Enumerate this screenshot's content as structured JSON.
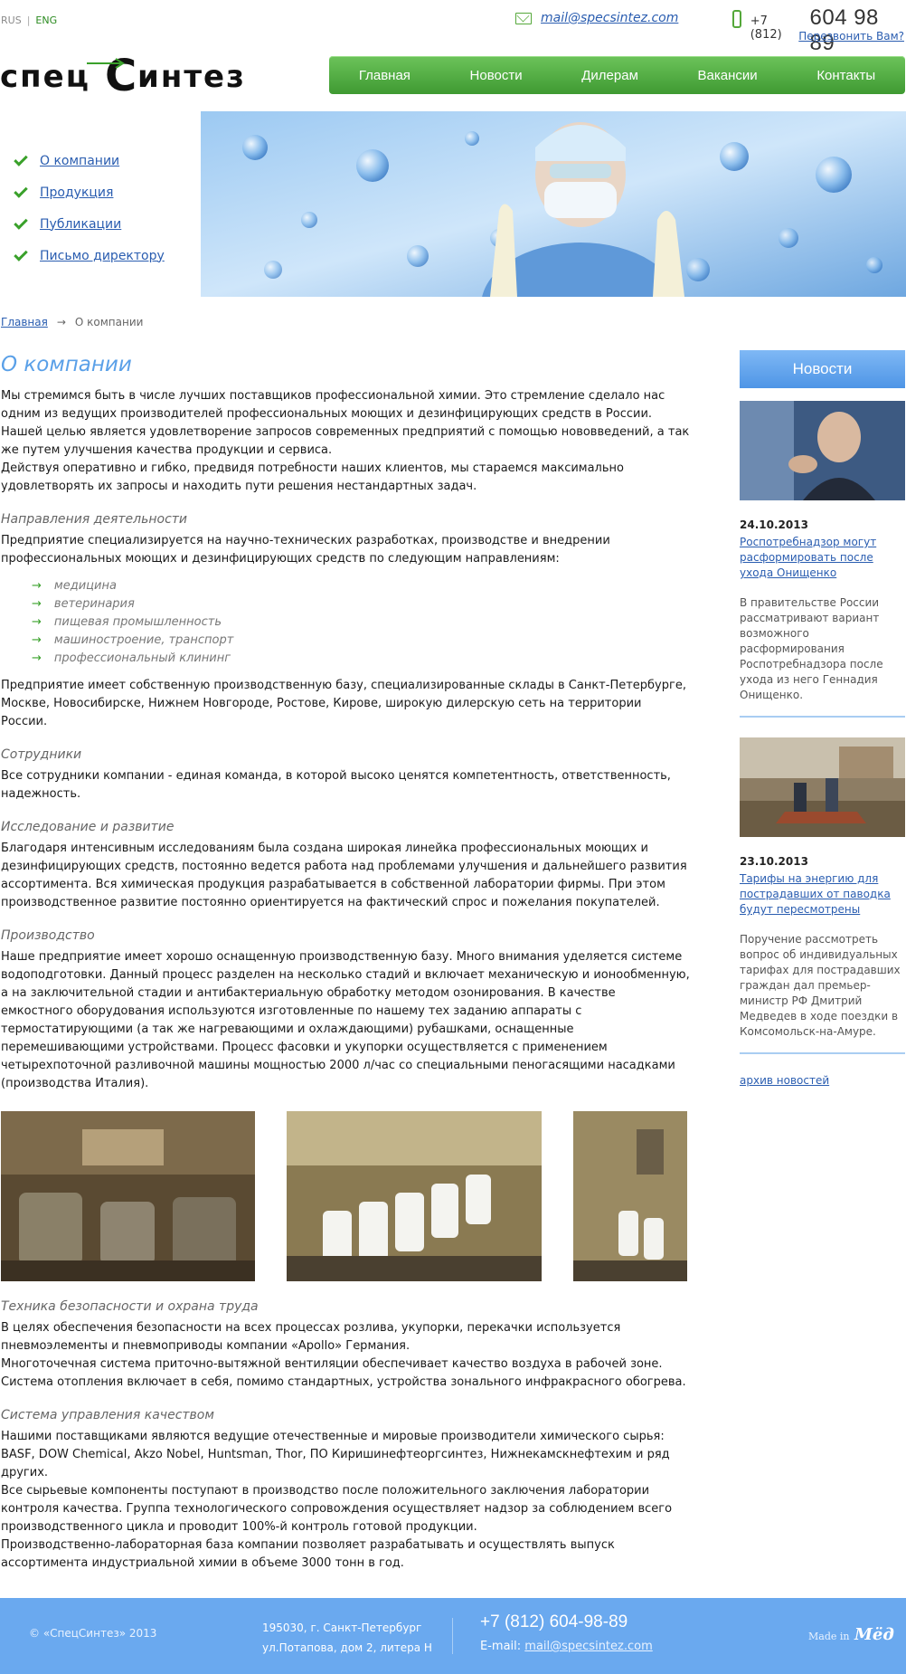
{
  "header": {
    "lang_rus": "RUS",
    "lang_eng": "ENG",
    "email": "mail@specsintez.com",
    "phone_code": "+7 (812)",
    "phone_number": "604 98 89",
    "callback": "Перезвонить Вам?",
    "logo_text": "спецСинтез"
  },
  "topnav": [
    "Главная",
    "Новости",
    "Дилерам",
    "Вакансии",
    "Контакты"
  ],
  "sidemenu": [
    "О компании",
    "Продукция",
    "Публикации",
    "Письмо директору"
  ],
  "breadcrumb": {
    "home": "Главная",
    "current": "О компании"
  },
  "main": {
    "title": "О компании",
    "intro": "Мы стремимся быть в числе лучших поставщиков профессиональной химии. Это стремление сделало нас одним из ведущих производителей профессиональных моющих и дезинфицирующих средств в России. Нашей целью является удовлетворение запросов современных предприятий с помощью нововведений, а так же путем улучшения качества продукции и сервиса.",
    "intro2": "Действуя оперативно и гибко, предвидя потребности наших клиентов, мы стараемся максимально удовлетворять их запросы и находить пути решения нестандартных задач.",
    "dir_title": "Направления деятельности",
    "dir_text": "Предприятие специализируется на научно-технических разработках, производстве и внедрении профессиональных моющих и дезинфицирующих средств по следующим направлениям:",
    "dir_list": [
      "медицина",
      "ветеринария",
      "пищевая промышленность",
      "машиностроение, транспорт",
      "профессиональный клининг"
    ],
    "dir_text2": "Предприятие имеет собственную производственную базу, специализированные склады в Санкт-Петербурге, Москве, Новосибирске, Нижнем Новгороде, Ростове, Кирове, широкую дилерскую сеть на территории России.",
    "staff_title": "Сотрудники",
    "staff_text": "Все сотрудники компании - единая команда, в которой высоко ценятся компетентность, ответственность, надежность.",
    "research_title": "Исследование и развитие",
    "research_text": "Благодаря интенсивным исследованиям была создана широкая линейка профессиональных моющих и дезинфицирующих средств, постоянно ведется работа над проблемами улучшения и дальнейшего развития ассортимента. Вся химическая продукция разрабатывается в собственной лаборатории фирмы. При этом производственное развитие постоянно ориентируется на фактический спрос и пожелания покупателей.",
    "production_title": "Производство",
    "production_text": "Наше предприятие имеет хорошо оснащенную производственную базу. Много внимания уделяется системе водоподготовки. Данный процесс разделен на несколько стадий и включает механическую и ионообменную, а на заключительной стадии и антибактериальную обработку методом озонирования. В качестве емкостного оборудования используются изготовленные по нашему тех заданию аппараты с термостатирующими (а так же нагревающими и охлаждающими) рубашками, оснащенные перемешивающими устройствами. Процесс фасовки и укупорки осуществляется с применением четырехпоточной разливочной машины мощностью 2000 л/час со специальными пеногасящими насадками (производства Италия).",
    "safety_title": "Техника безопасности и охрана труда",
    "safety_text": "В целях обеспечения безопасности на всех процессах розлива, укупорки, перекачки используется пневмоэлементы и пневмоприводы компании «Apollo» Германия.",
    "safety_text2": "Многоточечная система приточно-вытяжной вентиляции обеспечивает качество воздуха в рабочей зоне. Система отопления включает в себя, помимо стандартных, устройства зонального инфракрасного обогрева.",
    "quality_title": "Система управления качеством",
    "quality_text": "Нашими поставщиками являются ведущие отечественные и мировые производители химического сырья: BASF, DOW Chemical, Akzo Nobel, Huntsman, Thor, ПО Киришинефтеоргсинтез, Нижнекамскнефтехим и ряд других.",
    "quality_text2": "Все сырьевые компоненты поступают в производство после положительного заключения лаборатории контроля качества. Группа технологического сопровождения осуществляет надзор за соблюдением всего производственного цикла и проводит 100%-й контроль готовой продукции.",
    "quality_text3": "Производственно-лабораторная база компании позволяет разрабатывать и осуществлять выпуск ассортимента индустриальной химии в объеме 3000 тонн в год."
  },
  "news": {
    "title": "Новости",
    "items": [
      {
        "date": "24.10.2013",
        "link": "Роспотребнадзор могут расформировать после ухода Онищенко",
        "text": "В правительстве России рассматривают вариант возможного расформирования Роспотребнадзора после ухода из него Геннадия Онищенко."
      },
      {
        "date": "23.10.2013",
        "link": "Тарифы на энергию для пострадавших от паводка будут пересмотрены",
        "text": "Поручение рассмотреть вопрос об индивидуальных тарифах для пострадавших граждан дал премьер-министр РФ Дмитрий Медведев в ходе поездки в Комсомольск-на-Амуре."
      }
    ],
    "archive": "архив новостей"
  },
  "footer": {
    "copyright": "© «СпецСинтез» 2013",
    "address1": "195030, г. Санкт-Петербург",
    "address2": "ул.Потапова, дом 2, литера Н",
    "phone": "+7 (812) 604-98-89",
    "email_label": "E-mail:",
    "email": "mail@specsintez.com",
    "made_in": "Made in",
    "made_brand": "Мёд"
  },
  "colors": {
    "accent_green": "#3f9a32",
    "accent_blue": "#5aa0e8",
    "link": "#2a5db0",
    "footer_bg": "#6aa9ef"
  }
}
